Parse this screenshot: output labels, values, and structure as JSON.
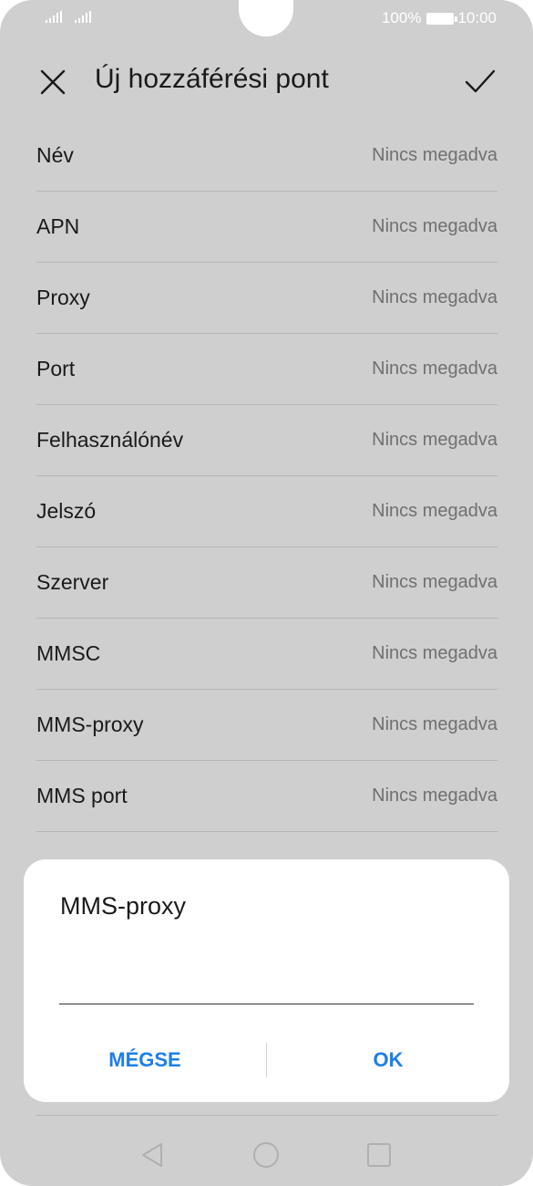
{
  "status_bar": {
    "battery_percent": "100%",
    "time": "10:00"
  },
  "header": {
    "title": "Új hozzáférési pont",
    "close_icon": "close-icon",
    "confirm_icon": "checkmark-icon"
  },
  "settings": [
    {
      "label": "Név",
      "value": "Nincs megadva"
    },
    {
      "label": "APN",
      "value": "Nincs megadva"
    },
    {
      "label": "Proxy",
      "value": "Nincs megadva"
    },
    {
      "label": "Port",
      "value": "Nincs megadva"
    },
    {
      "label": "Felhasználónév",
      "value": "Nincs megadva"
    },
    {
      "label": "Jelszó",
      "value": "Nincs megadva"
    },
    {
      "label": "Szerver",
      "value": "Nincs megadva"
    },
    {
      "label": "MMSC",
      "value": "Nincs megadva"
    },
    {
      "label": "MMS-proxy",
      "value": "Nincs megadva"
    },
    {
      "label": "MMS port",
      "value": "Nincs megadva"
    }
  ],
  "dialog": {
    "title": "MMS-proxy",
    "input_value": "",
    "cancel_label": "MÉGSE",
    "ok_label": "OK"
  },
  "nav_bar": {
    "icons": [
      "back-icon",
      "home-icon",
      "recents-icon"
    ]
  },
  "colors": {
    "accent": "#1e7ee6",
    "dim_background": "#cfcfcf"
  }
}
